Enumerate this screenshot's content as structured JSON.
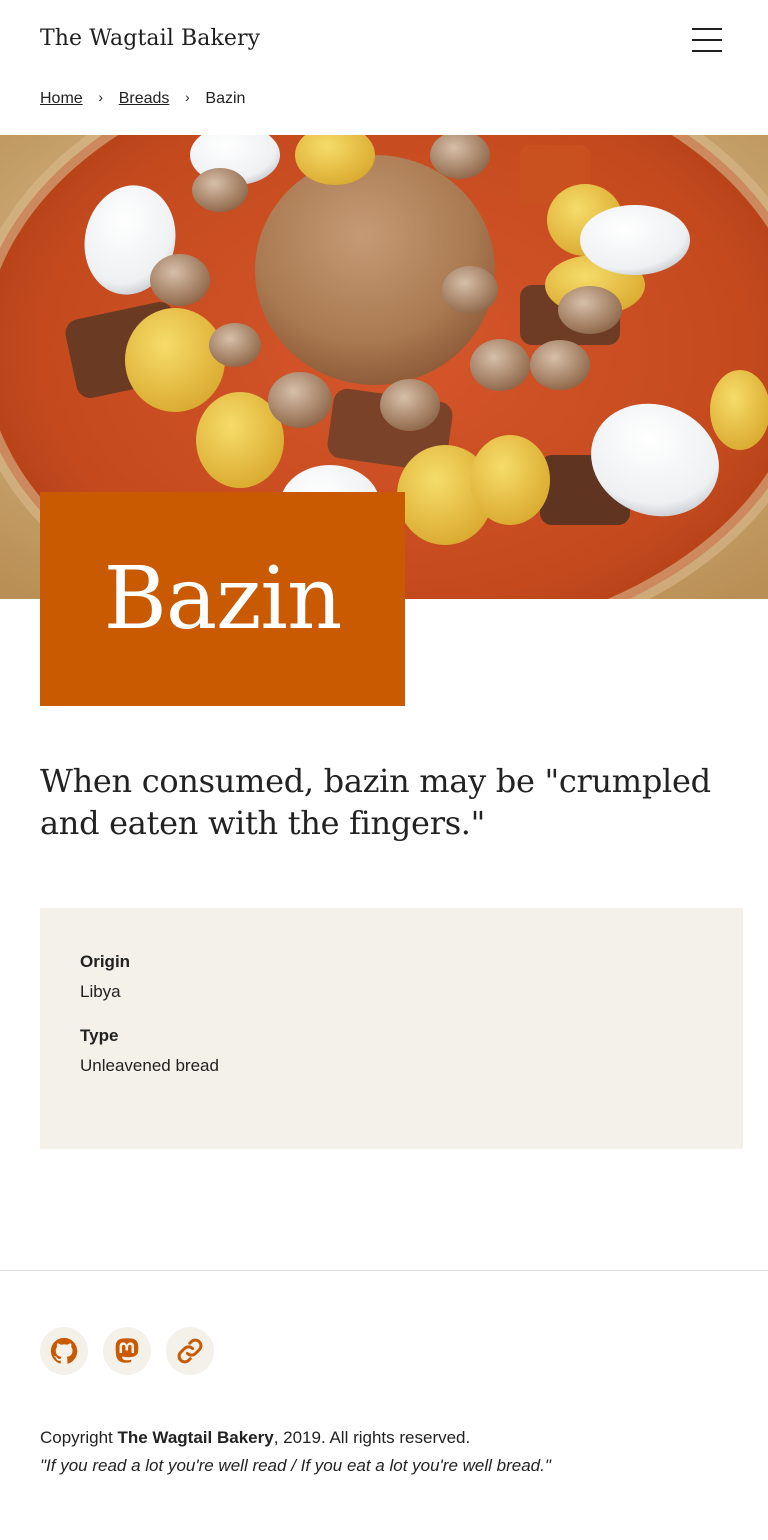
{
  "header": {
    "site_title": "The Wagtail Bakery",
    "menu_icon": "hamburger-menu-icon"
  },
  "breadcrumb": {
    "items": [
      {
        "label": "Home"
      },
      {
        "label": "Breads"
      }
    ],
    "current": "Bazin"
  },
  "hero": {
    "title": "Bazin",
    "image_alt": "Bazin"
  },
  "intro": "When consumed, bazin may be \"crumpled and eaten with the fingers.\"",
  "facts": [
    {
      "label": "Origin",
      "value": "Libya"
    },
    {
      "label": "Type",
      "value": "Unleavened bread"
    }
  ],
  "footer": {
    "social": [
      {
        "icon": "github-icon"
      },
      {
        "icon": "mastodon-icon"
      },
      {
        "icon": "link-icon"
      }
    ],
    "copyright_prefix": "Copyright ",
    "copyright_name": "The Wagtail Bakery",
    "copyright_suffix": ", 2019. All rights reserved.",
    "tagline": "\"If you read a lot you're well read / If you eat a lot you're well bread.\""
  },
  "colors": {
    "accent": "#c95a02",
    "panel": "#f4f1ea",
    "text": "#222222"
  }
}
